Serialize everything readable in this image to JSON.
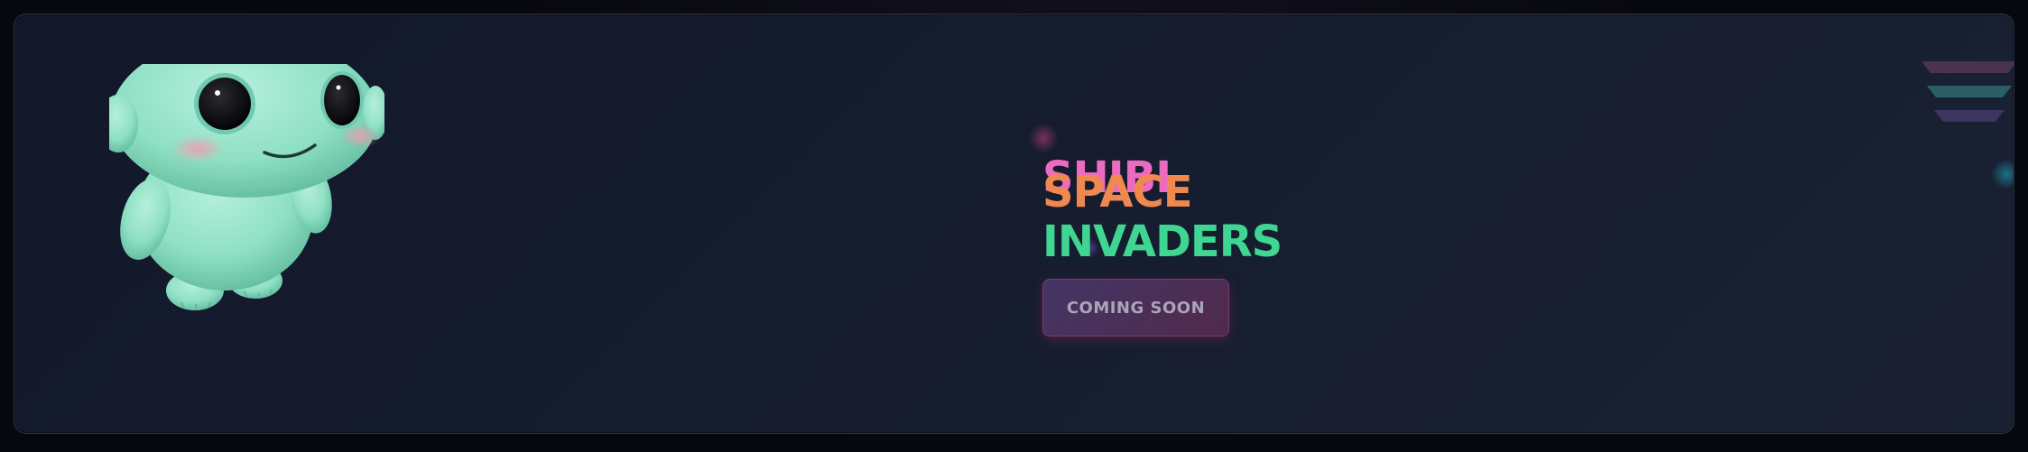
{
  "hero": {
    "title_lines": [
      "SHIBI",
      "SPACE",
      "INVADERS"
    ],
    "button_label": "COMING SOON"
  },
  "icons": {
    "mascot": "mascot-illustration",
    "menu": "menu-icon"
  },
  "colors": {
    "shibi": "#ec6bc0",
    "space": "#f0894f",
    "invaders": "#3fd592",
    "card_background": "#151c2e",
    "page_background": "#07080d",
    "mascot_body": "#8fe0c4"
  }
}
